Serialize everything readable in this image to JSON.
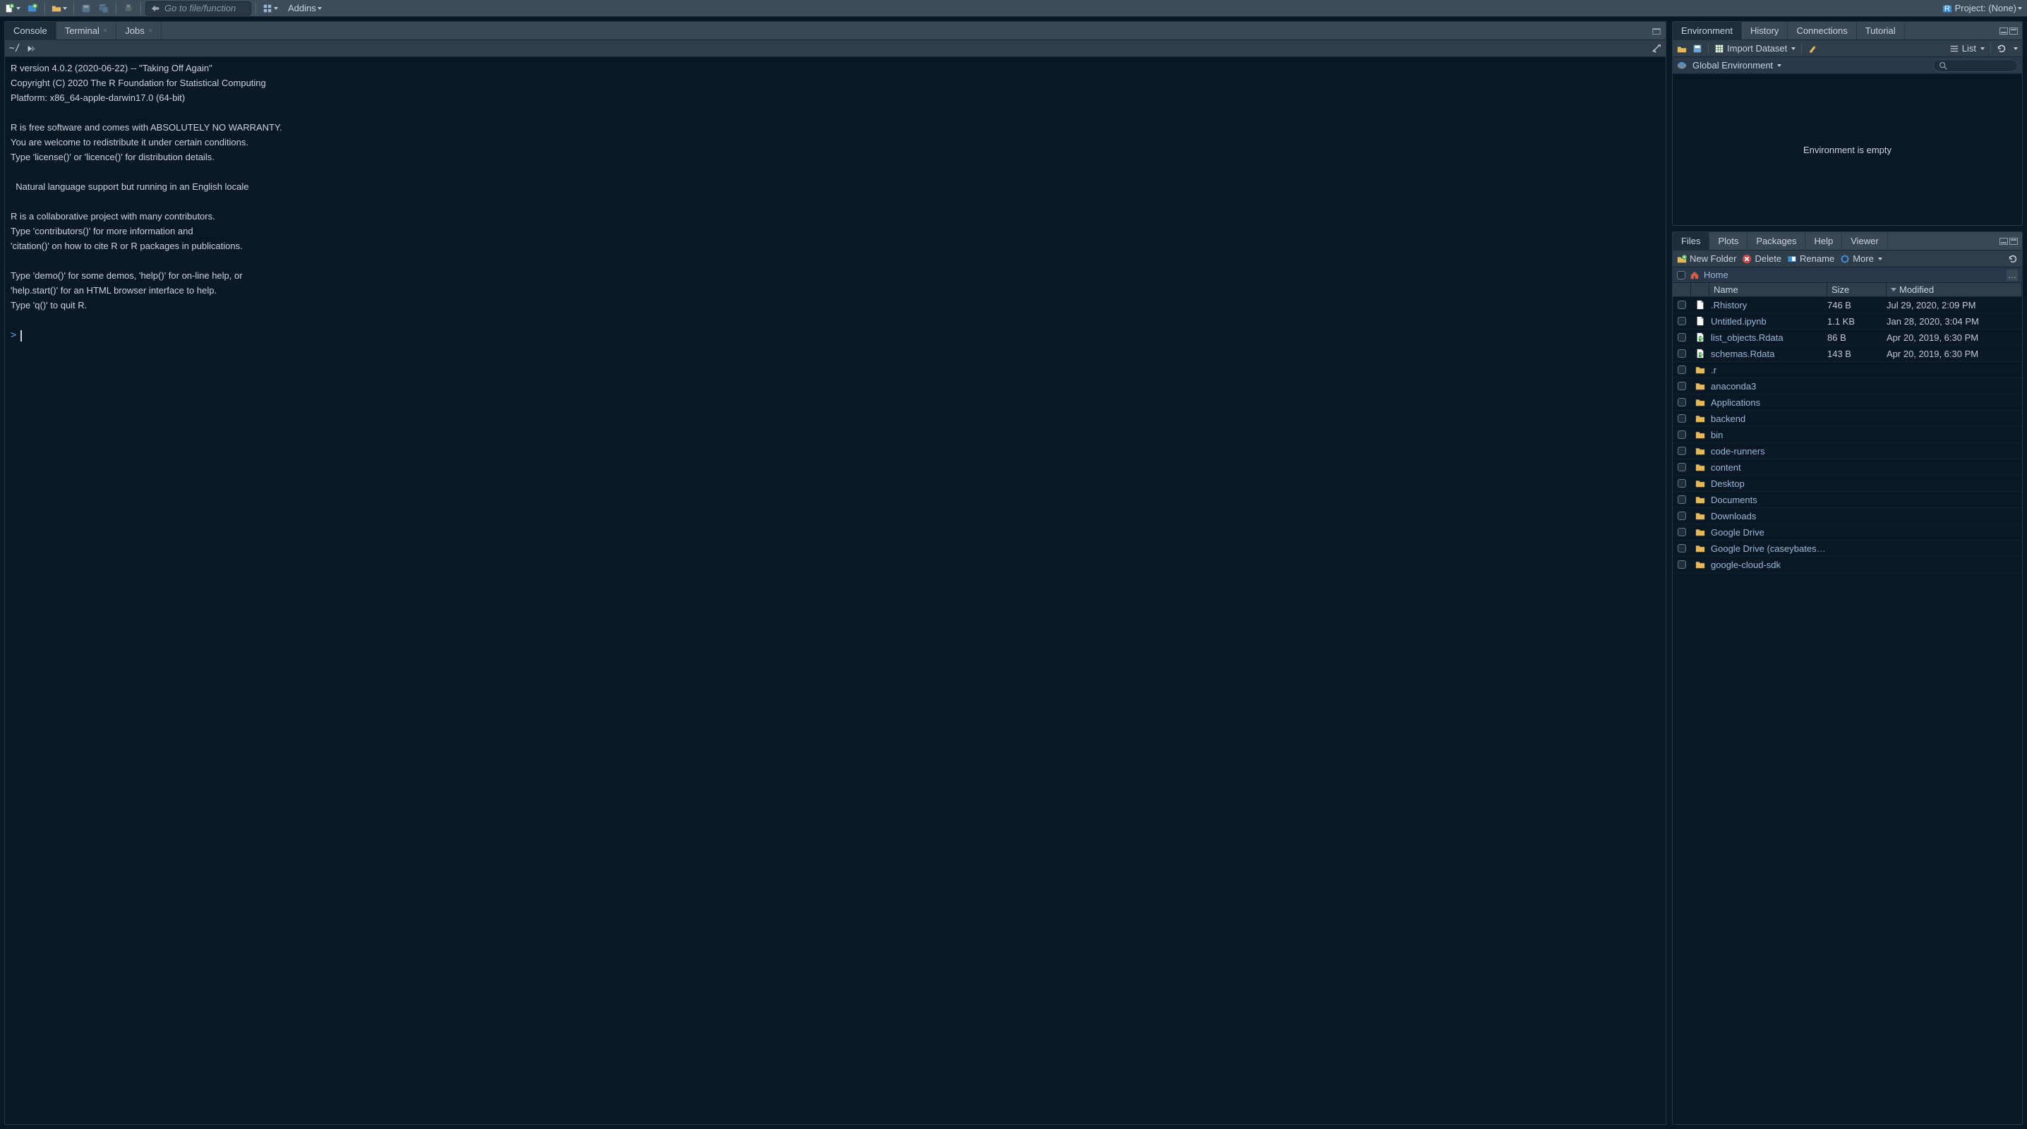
{
  "toolbar": {
    "goto_placeholder": "Go to file/function",
    "addins_label": "Addins",
    "project_label": "Project: (None)"
  },
  "left_pane": {
    "tabs": [
      {
        "label": "Console",
        "closable": false,
        "active": true
      },
      {
        "label": "Terminal",
        "closable": true,
        "active": false
      },
      {
        "label": "Jobs",
        "closable": true,
        "active": false
      }
    ],
    "console_path": "~/",
    "console_text": "R version 4.0.2 (2020-06-22) -- \"Taking Off Again\"\nCopyright (C) 2020 The R Foundation for Statistical Computing\nPlatform: x86_64-apple-darwin17.0 (64-bit)\n\nR is free software and comes with ABSOLUTELY NO WARRANTY.\nYou are welcome to redistribute it under certain conditions.\nType 'license()' or 'licence()' for distribution details.\n\n  Natural language support but running in an English locale\n\nR is a collaborative project with many contributors.\nType 'contributors()' for more information and\n'citation()' on how to cite R or R packages in publications.\n\nType 'demo()' for some demos, 'help()' for on-line help, or\n'help.start()' for an HTML browser interface to help.\nType 'q()' to quit R.\n",
    "prompt": ">"
  },
  "env_pane": {
    "tabs": [
      {
        "label": "Environment",
        "active": true
      },
      {
        "label": "History",
        "active": false
      },
      {
        "label": "Connections",
        "active": false
      },
      {
        "label": "Tutorial",
        "active": false
      }
    ],
    "import_label": "Import Dataset",
    "view_mode": "List",
    "scope_label": "Global Environment",
    "empty_msg": "Environment is empty"
  },
  "files_pane": {
    "tabs": [
      {
        "label": "Files",
        "active": true
      },
      {
        "label": "Plots",
        "active": false
      },
      {
        "label": "Packages",
        "active": false
      },
      {
        "label": "Help",
        "active": false
      },
      {
        "label": "Viewer",
        "active": false
      }
    ],
    "toolbar": {
      "new_folder": "New Folder",
      "delete": "Delete",
      "rename": "Rename",
      "more": "More"
    },
    "breadcrumb": "Home",
    "columns": {
      "name": "Name",
      "size": "Size",
      "modified": "Modified"
    },
    "rows": [
      {
        "icon": "doc",
        "name": ".Rhistory",
        "size": "746 B",
        "modified": "Jul 29, 2020, 2:09 PM"
      },
      {
        "icon": "doc",
        "name": "Untitled.ipynb",
        "size": "1.1 KB",
        "modified": "Jan 28, 2020, 3:04 PM"
      },
      {
        "icon": "rdata",
        "name": "list_objects.Rdata",
        "size": "86 B",
        "modified": "Apr 20, 2019, 6:30 PM"
      },
      {
        "icon": "rdata",
        "name": "schemas.Rdata",
        "size": "143 B",
        "modified": "Apr 20, 2019, 6:30 PM"
      },
      {
        "icon": "folder",
        "name": ".r",
        "size": "",
        "modified": ""
      },
      {
        "icon": "folder",
        "name": "anaconda3",
        "size": "",
        "modified": ""
      },
      {
        "icon": "folder",
        "name": "Applications",
        "size": "",
        "modified": ""
      },
      {
        "icon": "folder",
        "name": "backend",
        "size": "",
        "modified": ""
      },
      {
        "icon": "folder",
        "name": "bin",
        "size": "",
        "modified": ""
      },
      {
        "icon": "folder",
        "name": "code-runners",
        "size": "",
        "modified": ""
      },
      {
        "icon": "folder",
        "name": "content",
        "size": "",
        "modified": ""
      },
      {
        "icon": "folder",
        "name": "Desktop",
        "size": "",
        "modified": ""
      },
      {
        "icon": "folder",
        "name": "Documents",
        "size": "",
        "modified": ""
      },
      {
        "icon": "folder",
        "name": "Downloads",
        "size": "",
        "modified": ""
      },
      {
        "icon": "folder",
        "name": "Google Drive",
        "size": "",
        "modified": ""
      },
      {
        "icon": "folder",
        "name": "Google Drive (caseybates@gmai...",
        "size": "",
        "modified": ""
      },
      {
        "icon": "folder",
        "name": "google-cloud-sdk",
        "size": "",
        "modified": ""
      }
    ]
  }
}
